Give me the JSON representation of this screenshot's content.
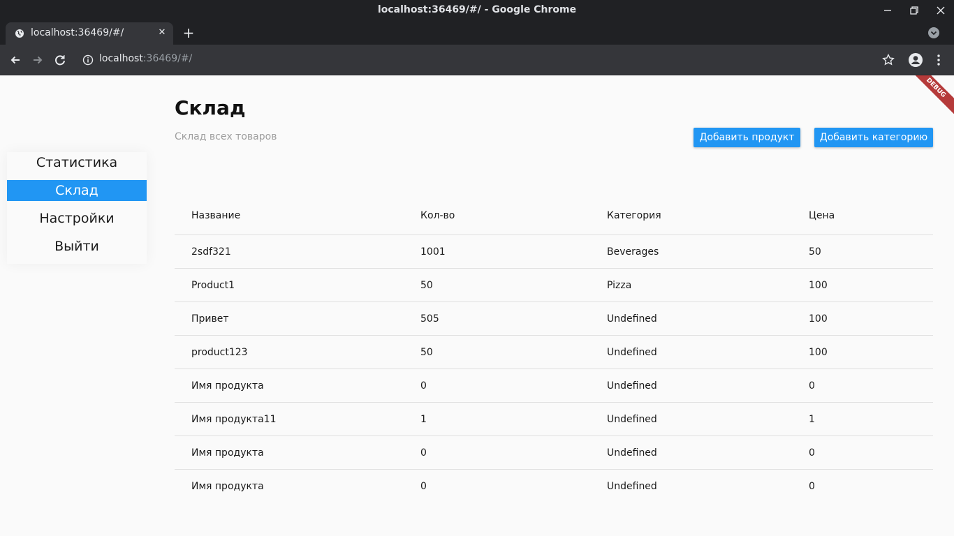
{
  "window": {
    "title": "localhost:36469/#/ - Google Chrome"
  },
  "browser": {
    "tab_title": "localhost:36469/#/",
    "url_host": "localhost",
    "url_rest": ":36469/#/"
  },
  "app": {
    "debug_label": "DEBUG",
    "nav": [
      {
        "label": "Статистика",
        "active": false
      },
      {
        "label": "Склад",
        "active": true
      },
      {
        "label": "Настройки",
        "active": false
      },
      {
        "label": "Выйти",
        "active": false
      }
    ],
    "page_title": "Склад",
    "page_subtitle": "Склад всех товаров",
    "buttons": {
      "add_product": "Добавить продукт",
      "add_category": "Добавить категорию"
    },
    "table": {
      "headers": [
        "Название",
        "Кол-во",
        "Категория",
        "Цена"
      ],
      "rows": [
        [
          "2sdf321",
          "1001",
          "Beverages",
          "50"
        ],
        [
          "Product1",
          "50",
          "Pizza",
          "100"
        ],
        [
          "Привет",
          "505",
          "Undefined",
          "100"
        ],
        [
          "product123",
          "50",
          "Undefined",
          "100"
        ],
        [
          "Имя продукта",
          "0",
          "Undefined",
          "0"
        ],
        [
          "Имя продукта11",
          "1",
          "Undefined",
          "1"
        ],
        [
          "Имя продукта",
          "0",
          "Undefined",
          "0"
        ],
        [
          "Имя продукта",
          "0",
          "Undefined",
          "0"
        ]
      ]
    },
    "colors": {
      "accent": "#2196f3",
      "background": "#fafafa"
    }
  }
}
